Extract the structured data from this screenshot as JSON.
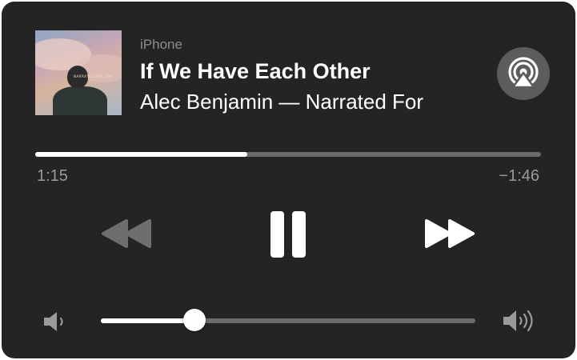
{
  "now_playing": {
    "device": "iPhone",
    "title": "If We Have Each Other",
    "artist_line": "Alec Benjamin — Narrated For",
    "artwork_text": "NARRATED FOR YOU"
  },
  "playback": {
    "progress": 0.42,
    "elapsed": "1:15",
    "remaining": "−1:46",
    "state": "playing"
  },
  "volume": {
    "level": 0.25
  },
  "icons": {
    "airplay": "airplay-icon",
    "rewind": "rewind-icon",
    "pause": "pause-icon",
    "forward": "fast-forward-icon",
    "volume_low": "volume-low-icon",
    "volume_high": "volume-high-icon"
  },
  "colors": {
    "background": "#242424",
    "accent": "#ffffff",
    "track": "#6b6b6b",
    "secondary_text": "#8c8c8c",
    "inactive_control": "#6e6e6e"
  }
}
